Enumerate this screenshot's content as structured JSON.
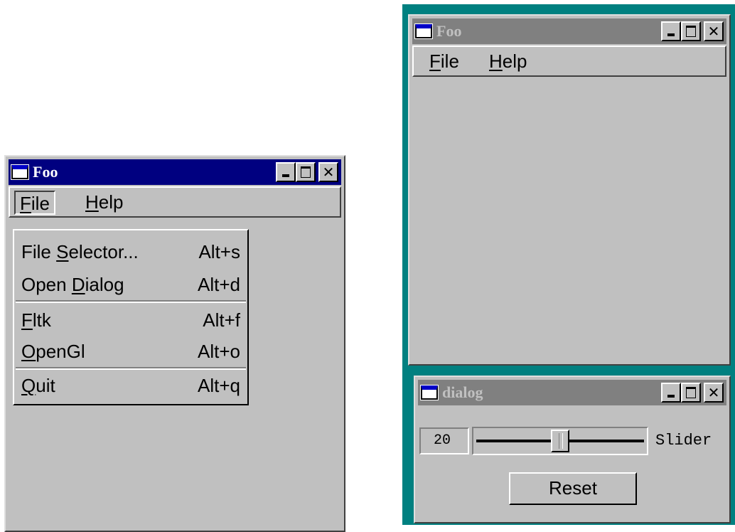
{
  "screens": {
    "left_window": {
      "title": "Foo",
      "menubar": [
        {
          "label": "File",
          "mnemonic": "F",
          "rest": "ile",
          "state": "open"
        },
        {
          "label": "Help",
          "mnemonic": "H",
          "rest": "elp"
        }
      ],
      "file_menu": [
        {
          "pre": "File ",
          "mnemonic": "S",
          "post": "elector...",
          "shortcut": "Alt+s"
        },
        {
          "pre": "Open ",
          "mnemonic": "D",
          "post": "ialog",
          "shortcut": "Alt+d"
        },
        {
          "pre": "",
          "mnemonic": "F",
          "post": "ltk",
          "shortcut": "Alt+f"
        },
        {
          "pre": "",
          "mnemonic": "O",
          "post": "penGl",
          "shortcut": "Alt+o"
        },
        {
          "pre": "",
          "mnemonic": "Q",
          "post": "uit",
          "shortcut": "Alt+q"
        }
      ]
    },
    "right_window": {
      "title": "Foo",
      "menubar": [
        {
          "label": "File",
          "mnemonic": "F",
          "rest": "ile"
        },
        {
          "label": "Help",
          "mnemonic": "H",
          "rest": "elp"
        }
      ]
    },
    "dialog": {
      "title": "dialog",
      "value": "20",
      "slider_label": "Slider",
      "slider_fraction": 0.5,
      "reset_label": "Reset"
    }
  },
  "colors": {
    "desktop": "#008080",
    "face": "#c0c0c0",
    "active_title": "#000080",
    "inactive_title": "#808080"
  },
  "icons": {
    "window": "window-icon",
    "minimize": "minimize-icon",
    "maximize": "maximize-icon",
    "close": "close-icon"
  }
}
